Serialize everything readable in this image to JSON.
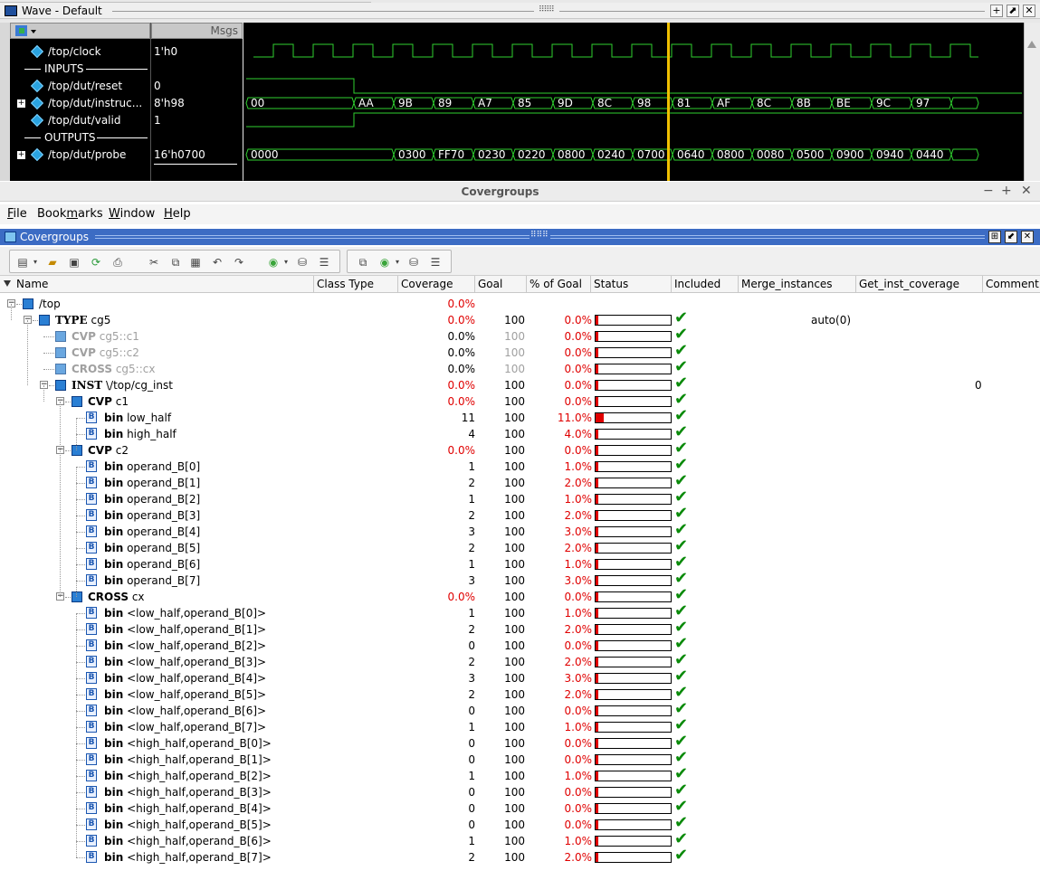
{
  "wave": {
    "title": "Wave - Default",
    "msgs_header": "Msgs",
    "signals": [
      {
        "kind": "signal",
        "name": "/top/clock",
        "value": "1'h0",
        "expandable": false
      },
      {
        "kind": "section",
        "name": "INPUTS"
      },
      {
        "kind": "signal",
        "name": "/top/dut/reset",
        "value": "0",
        "expandable": false
      },
      {
        "kind": "signal",
        "name": "/top/dut/instruc...",
        "value": "8'h98",
        "expandable": true
      },
      {
        "kind": "signal",
        "name": "/top/dut/valid",
        "value": "1",
        "expandable": false
      },
      {
        "kind": "section",
        "name": "OUTPUTS"
      },
      {
        "kind": "signal",
        "name": "/top/dut/probe",
        "value": "16'h0700",
        "expandable": true
      }
    ],
    "instruc_labels": [
      "00",
      "AA",
      "9B",
      "89",
      "A7",
      "85",
      "9D",
      "8C",
      "98",
      "81",
      "AF",
      "8C",
      "8B",
      "BE",
      "9C",
      "97"
    ],
    "probe_labels": [
      "0000",
      "0300",
      "FF70",
      "0230",
      "0220",
      "0800",
      "0240",
      "0700",
      "0640",
      "0800",
      "0080",
      "0500",
      "0900",
      "0940",
      "0440"
    ]
  },
  "covergroups": {
    "window_title": "Covergroups",
    "panel_title": "Covergroups",
    "menu": [
      {
        "label": "File"
      },
      {
        "label": "Bookmarks"
      },
      {
        "label": "Window"
      },
      {
        "label": "Help"
      }
    ],
    "columns": [
      "Name",
      "Class Type",
      "Coverage",
      "Goal",
      "% of Goal",
      "Status",
      "Included",
      "Merge_instances",
      "Get_inst_coverage",
      "Comment"
    ],
    "rows": [
      {
        "depth": 0,
        "icon": "cube",
        "toggle": "-",
        "kw": "",
        "name": "/top",
        "coverage": "0.0%",
        "cov_red": true,
        "goal": "",
        "pct": "",
        "status": null,
        "included": false,
        "merge": "",
        "comment": "",
        "dim": false
      },
      {
        "depth": 1,
        "icon": "cube",
        "toggle": "-",
        "kw": "TYPE",
        "name": "cg5",
        "coverage": "0.0%",
        "cov_red": true,
        "goal": "100",
        "pct": "0.0%",
        "status": 0.0,
        "included": true,
        "merge": "auto(0)",
        "comment": "",
        "dim": false,
        "kw_serif": true
      },
      {
        "depth": 2,
        "icon": "cube-dim",
        "toggle": "",
        "kw": "CVP",
        "name": "cg5::c1",
        "coverage": "0.0%",
        "cov_red": false,
        "goal": "100",
        "pct": "0.0%",
        "status": 0.0,
        "included": true,
        "merge": "",
        "comment": "",
        "dim": true
      },
      {
        "depth": 2,
        "icon": "cube-dim",
        "toggle": "",
        "kw": "CVP",
        "name": "cg5::c2",
        "coverage": "0.0%",
        "cov_red": false,
        "goal": "100",
        "pct": "0.0%",
        "status": 0.0,
        "included": true,
        "merge": "",
        "comment": "",
        "dim": true
      },
      {
        "depth": 2,
        "icon": "cube-dim",
        "toggle": "",
        "kw": "CROSS",
        "name": "cg5::cx",
        "coverage": "0.0%",
        "cov_red": false,
        "goal": "100",
        "pct": "0.0%",
        "status": 0.0,
        "included": true,
        "merge": "",
        "comment": "",
        "dim": true
      },
      {
        "depth": 2,
        "icon": "cube",
        "toggle": "-",
        "kw": "INST",
        "name": "\\/top/cg_inst",
        "coverage": "0.0%",
        "cov_red": true,
        "goal": "100",
        "pct": "0.0%",
        "status": 0.0,
        "included": true,
        "merge": "",
        "comment": "0",
        "dim": false,
        "kw_serif": true
      },
      {
        "depth": 3,
        "icon": "cube",
        "toggle": "-",
        "kw": "CVP",
        "name": "c1",
        "coverage": "0.0%",
        "cov_red": true,
        "goal": "100",
        "pct": "0.0%",
        "status": 0.0,
        "included": true,
        "merge": "",
        "comment": "",
        "dim": false
      },
      {
        "depth": 4,
        "icon": "bin",
        "toggle": "",
        "kw": "bin",
        "name": "low_half",
        "coverage": "11",
        "cov_red": false,
        "goal": "100",
        "pct": "11.0%",
        "status": 11.0,
        "included": true,
        "merge": "",
        "comment": "",
        "dim": false
      },
      {
        "depth": 4,
        "icon": "bin",
        "toggle": "",
        "kw": "bin",
        "name": "high_half",
        "coverage": "4",
        "cov_red": false,
        "goal": "100",
        "pct": "4.0%",
        "status": 4.0,
        "included": true,
        "merge": "",
        "comment": "",
        "dim": false
      },
      {
        "depth": 3,
        "icon": "cube",
        "toggle": "-",
        "kw": "CVP",
        "name": "c2",
        "coverage": "0.0%",
        "cov_red": true,
        "goal": "100",
        "pct": "0.0%",
        "status": 0.0,
        "included": true,
        "merge": "",
        "comment": "",
        "dim": false
      },
      {
        "depth": 4,
        "icon": "bin",
        "toggle": "",
        "kw": "bin",
        "name": "operand_B[0]",
        "coverage": "1",
        "cov_red": false,
        "goal": "100",
        "pct": "1.0%",
        "status": 1.0,
        "included": true,
        "merge": "",
        "comment": "",
        "dim": false
      },
      {
        "depth": 4,
        "icon": "bin",
        "toggle": "",
        "kw": "bin",
        "name": "operand_B[1]",
        "coverage": "2",
        "cov_red": false,
        "goal": "100",
        "pct": "2.0%",
        "status": 2.0,
        "included": true,
        "merge": "",
        "comment": "",
        "dim": false
      },
      {
        "depth": 4,
        "icon": "bin",
        "toggle": "",
        "kw": "bin",
        "name": "operand_B[2]",
        "coverage": "1",
        "cov_red": false,
        "goal": "100",
        "pct": "1.0%",
        "status": 1.0,
        "included": true,
        "merge": "",
        "comment": "",
        "dim": false
      },
      {
        "depth": 4,
        "icon": "bin",
        "toggle": "",
        "kw": "bin",
        "name": "operand_B[3]",
        "coverage": "2",
        "cov_red": false,
        "goal": "100",
        "pct": "2.0%",
        "status": 2.0,
        "included": true,
        "merge": "",
        "comment": "",
        "dim": false
      },
      {
        "depth": 4,
        "icon": "bin",
        "toggle": "",
        "kw": "bin",
        "name": "operand_B[4]",
        "coverage": "3",
        "cov_red": false,
        "goal": "100",
        "pct": "3.0%",
        "status": 3.0,
        "included": true,
        "merge": "",
        "comment": "",
        "dim": false
      },
      {
        "depth": 4,
        "icon": "bin",
        "toggle": "",
        "kw": "bin",
        "name": "operand_B[5]",
        "coverage": "2",
        "cov_red": false,
        "goal": "100",
        "pct": "2.0%",
        "status": 2.0,
        "included": true,
        "merge": "",
        "comment": "",
        "dim": false
      },
      {
        "depth": 4,
        "icon": "bin",
        "toggle": "",
        "kw": "bin",
        "name": "operand_B[6]",
        "coverage": "1",
        "cov_red": false,
        "goal": "100",
        "pct": "1.0%",
        "status": 1.0,
        "included": true,
        "merge": "",
        "comment": "",
        "dim": false
      },
      {
        "depth": 4,
        "icon": "bin",
        "toggle": "",
        "kw": "bin",
        "name": "operand_B[7]",
        "coverage": "3",
        "cov_red": false,
        "goal": "100",
        "pct": "3.0%",
        "status": 3.0,
        "included": true,
        "merge": "",
        "comment": "",
        "dim": false
      },
      {
        "depth": 3,
        "icon": "cube",
        "toggle": "-",
        "kw": "CROSS",
        "name": "cx",
        "coverage": "0.0%",
        "cov_red": true,
        "goal": "100",
        "pct": "0.0%",
        "status": 0.0,
        "included": true,
        "merge": "",
        "comment": "",
        "dim": false
      },
      {
        "depth": 4,
        "icon": "bin",
        "toggle": "",
        "kw": "bin",
        "name": "<low_half,operand_B[0]>",
        "coverage": "1",
        "cov_red": false,
        "goal": "100",
        "pct": "1.0%",
        "status": 1.0,
        "included": true,
        "merge": "",
        "comment": "",
        "dim": false
      },
      {
        "depth": 4,
        "icon": "bin",
        "toggle": "",
        "kw": "bin",
        "name": "<low_half,operand_B[1]>",
        "coverage": "2",
        "cov_red": false,
        "goal": "100",
        "pct": "2.0%",
        "status": 2.0,
        "included": true,
        "merge": "",
        "comment": "",
        "dim": false
      },
      {
        "depth": 4,
        "icon": "bin",
        "toggle": "",
        "kw": "bin",
        "name": "<low_half,operand_B[2]>",
        "coverage": "0",
        "cov_red": false,
        "goal": "100",
        "pct": "0.0%",
        "status": 0.0,
        "included": true,
        "merge": "",
        "comment": "",
        "dim": false
      },
      {
        "depth": 4,
        "icon": "bin",
        "toggle": "",
        "kw": "bin",
        "name": "<low_half,operand_B[3]>",
        "coverage": "2",
        "cov_red": false,
        "goal": "100",
        "pct": "2.0%",
        "status": 2.0,
        "included": true,
        "merge": "",
        "comment": "",
        "dim": false
      },
      {
        "depth": 4,
        "icon": "bin",
        "toggle": "",
        "kw": "bin",
        "name": "<low_half,operand_B[4]>",
        "coverage": "3",
        "cov_red": false,
        "goal": "100",
        "pct": "3.0%",
        "status": 3.0,
        "included": true,
        "merge": "",
        "comment": "",
        "dim": false
      },
      {
        "depth": 4,
        "icon": "bin",
        "toggle": "",
        "kw": "bin",
        "name": "<low_half,operand_B[5]>",
        "coverage": "2",
        "cov_red": false,
        "goal": "100",
        "pct": "2.0%",
        "status": 2.0,
        "included": true,
        "merge": "",
        "comment": "",
        "dim": false
      },
      {
        "depth": 4,
        "icon": "bin",
        "toggle": "",
        "kw": "bin",
        "name": "<low_half,operand_B[6]>",
        "coverage": "0",
        "cov_red": false,
        "goal": "100",
        "pct": "0.0%",
        "status": 0.0,
        "included": true,
        "merge": "",
        "comment": "",
        "dim": false
      },
      {
        "depth": 4,
        "icon": "bin",
        "toggle": "",
        "kw": "bin",
        "name": "<low_half,operand_B[7]>",
        "coverage": "1",
        "cov_red": false,
        "goal": "100",
        "pct": "1.0%",
        "status": 1.0,
        "included": true,
        "merge": "",
        "comment": "",
        "dim": false
      },
      {
        "depth": 4,
        "icon": "bin",
        "toggle": "",
        "kw": "bin",
        "name": "<high_half,operand_B[0]>",
        "coverage": "0",
        "cov_red": false,
        "goal": "100",
        "pct": "0.0%",
        "status": 0.0,
        "included": true,
        "merge": "",
        "comment": "",
        "dim": false
      },
      {
        "depth": 4,
        "icon": "bin",
        "toggle": "",
        "kw": "bin",
        "name": "<high_half,operand_B[1]>",
        "coverage": "0",
        "cov_red": false,
        "goal": "100",
        "pct": "0.0%",
        "status": 0.0,
        "included": true,
        "merge": "",
        "comment": "",
        "dim": false
      },
      {
        "depth": 4,
        "icon": "bin",
        "toggle": "",
        "kw": "bin",
        "name": "<high_half,operand_B[2]>",
        "coverage": "1",
        "cov_red": false,
        "goal": "100",
        "pct": "1.0%",
        "status": 1.0,
        "included": true,
        "merge": "",
        "comment": "",
        "dim": false
      },
      {
        "depth": 4,
        "icon": "bin",
        "toggle": "",
        "kw": "bin",
        "name": "<high_half,operand_B[3]>",
        "coverage": "0",
        "cov_red": false,
        "goal": "100",
        "pct": "0.0%",
        "status": 0.0,
        "included": true,
        "merge": "",
        "comment": "",
        "dim": false
      },
      {
        "depth": 4,
        "icon": "bin",
        "toggle": "",
        "kw": "bin",
        "name": "<high_half,operand_B[4]>",
        "coverage": "0",
        "cov_red": false,
        "goal": "100",
        "pct": "0.0%",
        "status": 0.0,
        "included": true,
        "merge": "",
        "comment": "",
        "dim": false
      },
      {
        "depth": 4,
        "icon": "bin",
        "toggle": "",
        "kw": "bin",
        "name": "<high_half,operand_B[5]>",
        "coverage": "0",
        "cov_red": false,
        "goal": "100",
        "pct": "0.0%",
        "status": 0.0,
        "included": true,
        "merge": "",
        "comment": "",
        "dim": false
      },
      {
        "depth": 4,
        "icon": "bin",
        "toggle": "",
        "kw": "bin",
        "name": "<high_half,operand_B[6]>",
        "coverage": "1",
        "cov_red": false,
        "goal": "100",
        "pct": "1.0%",
        "status": 1.0,
        "included": true,
        "merge": "",
        "comment": "",
        "dim": false
      },
      {
        "depth": 4,
        "icon": "bin",
        "toggle": "",
        "kw": "bin",
        "name": "<high_half,operand_B[7]>",
        "coverage": "2",
        "cov_red": false,
        "goal": "100",
        "pct": "2.0%",
        "status": 2.0,
        "included": true,
        "merge": "",
        "comment": "",
        "dim": false
      }
    ],
    "colors": {
      "red": "#e00000",
      "check": "#0a8a0a",
      "panel_blue": "#3c6cc4"
    }
  }
}
